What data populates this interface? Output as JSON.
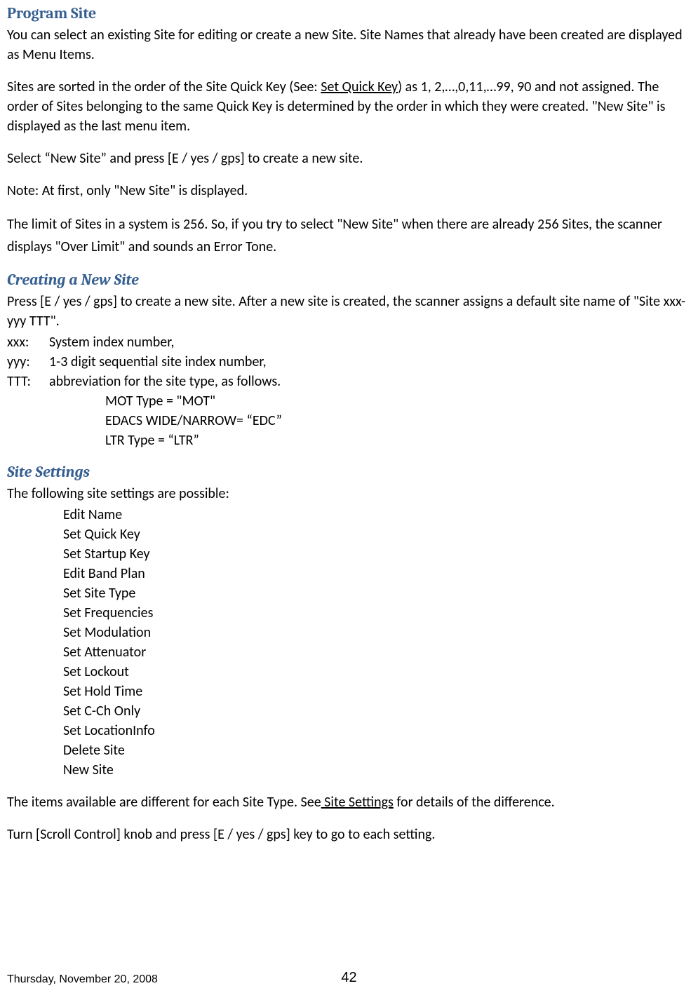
{
  "headings": {
    "program_site": "Program Site",
    "creating_new_site": "Creating a New Site",
    "site_settings": "Site Settings"
  },
  "program_site": {
    "p1": "You can select an existing Site for editing or create a new Site. Site Names that already have been created are displayed as Menu Items.",
    "p2a": "Sites are sorted in the order of the Site Quick Key (See: ",
    "p2_link": "Set Quick Key",
    "p2b": ") as 1, 2,…,0,11,…99, 90 and not assigned. The order of Sites belonging to the same Quick Key is determined by the order in which they were created. \"New Site\" is displayed as the last menu item.",
    "p3": "Select “New Site” and press [E / yes / gps] to create a new site.",
    "p4": "Note: At first, only \"New Site\" is displayed.",
    "p5": "The limit of Sites in a system is 256. So, if you try to select \"New Site\" when there are already 256 Sites, the scanner displays \"Over Limit\" and sounds an Error Tone."
  },
  "creating_new_site": {
    "intro": "Press [E / yes / gps] to create a new site. After a new site is created, the scanner assigns a default site name of \"Site xxx-yyy TTT\".",
    "defs": [
      {
        "key": " xxx:",
        "val": "System index number,"
      },
      {
        "key": "yyy:",
        "val": "1-3 digit sequential site index number,"
      },
      {
        "key": "TTT:",
        "val": "abbreviation for the site type, as follows."
      }
    ],
    "types": [
      "MOT Type = \"MOT\"",
      "EDACS WIDE/NARROW= “EDC”",
      "LTR Type = “LTR”"
    ]
  },
  "site_settings": {
    "intro": "The following site settings are possible:",
    "items": [
      "Edit Name",
      "Set Quick Key",
      "Set Startup Key",
      "Edit Band Plan",
      "Set Site Type",
      "Set Frequencies",
      "Set Modulation",
      "Set Attenuator",
      "Set Lockout",
      "Set Hold Time",
      "Set C-Ch Only",
      "Set LocationInfo",
      "Delete Site",
      "New Site"
    ],
    "note_a": "The items available are different for each Site Type. See",
    "note_link": " Site Settings",
    "note_b": "  for details of the difference.",
    "instr": "Turn [Scroll Control] knob and press [E / yes / gps] key to go to each setting."
  },
  "footer": {
    "date": "Thursday, November 20, 2008",
    "page": "42"
  }
}
